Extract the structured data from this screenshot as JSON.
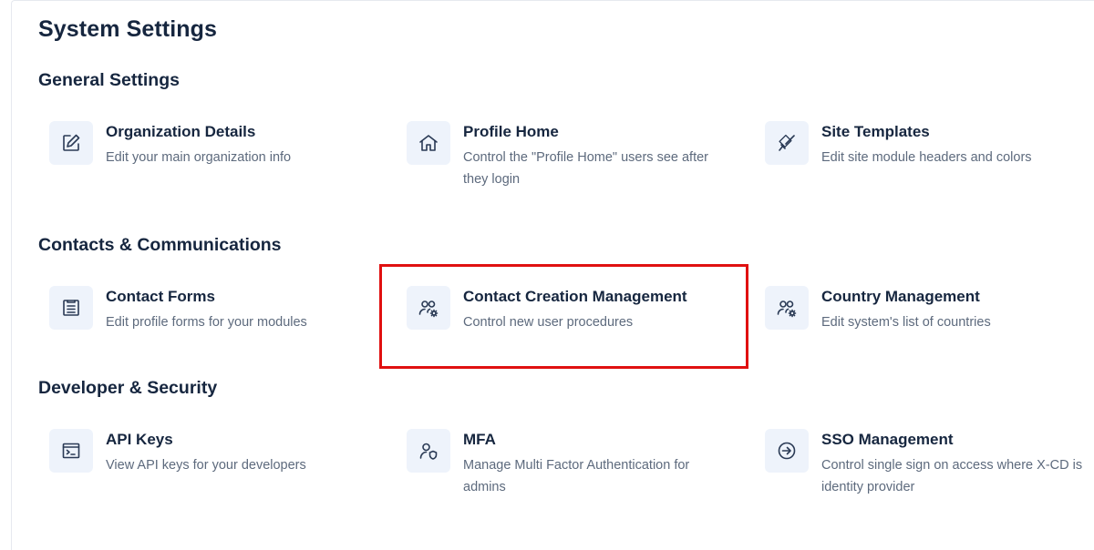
{
  "page": {
    "title": "System Settings"
  },
  "sections": [
    {
      "title": "General Settings",
      "items": [
        {
          "title": "Organization Details",
          "description": "Edit your main organization info",
          "icon": "edit-icon"
        },
        {
          "title": "Profile Home",
          "description": "Control the \"Profile Home\" users see after they login",
          "icon": "home-icon"
        },
        {
          "title": "Site Templates",
          "description": "Edit site module headers and colors",
          "icon": "brush-icon"
        }
      ]
    },
    {
      "title": "Contacts & Communications",
      "items": [
        {
          "title": "Contact Forms",
          "description": "Edit profile forms for your modules",
          "icon": "form-icon"
        },
        {
          "title": "Contact Creation Management",
          "description": "Control new user procedures",
          "icon": "users-gear-icon"
        },
        {
          "title": "Country Management",
          "description": "Edit system's list of countries",
          "icon": "users-gear-icon"
        }
      ]
    },
    {
      "title": "Developer & Security",
      "items": [
        {
          "title": "API Keys",
          "description": "View API keys for your developers",
          "icon": "terminal-icon"
        },
        {
          "title": "MFA",
          "description": "Manage Multi Factor Authentication for admins",
          "icon": "user-shield-icon"
        },
        {
          "title": "SSO Management",
          "description": "Control single sign on access where X-CD is identity provider",
          "icon": "sign-in-icon"
        }
      ]
    }
  ],
  "highlight": {
    "target": "Contact Creation Management",
    "color": "#e01010"
  },
  "colors": {
    "icon_bg": "#eef3fb",
    "title": "#16263f",
    "description": "#5d6a7d"
  }
}
